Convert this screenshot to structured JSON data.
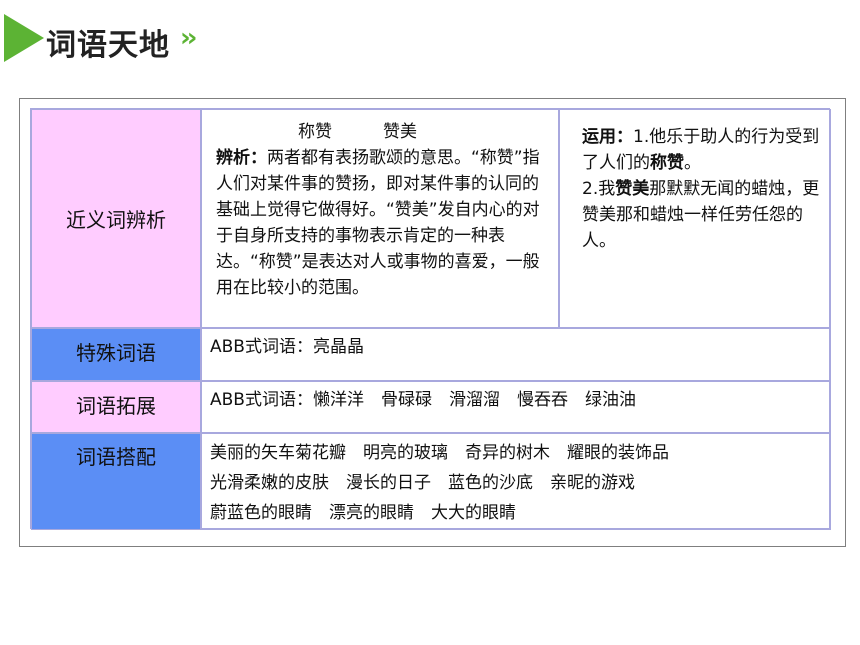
{
  "header": {
    "title": "词语天地",
    "chevrons": "››",
    "accent_color": "#5cb334"
  },
  "table": {
    "rows": [
      {
        "label": "近义词辨析",
        "label_bg": "#ffccff",
        "analysis": {
          "words": "称赞　　　赞美",
          "prefix": "辨析：",
          "body": "两者都有表扬歌颂的意思。“称赞”指人们对某件事的赞扬，即对某件事的认同的基础上觉得它做得好。“赞美”发自内心的对于自身所支持的事物表示肯定的一种表达。“称赞”是表达对人或事物的喜爱，一般用在比较小的范围。"
        },
        "usage": {
          "prefix": "运用：",
          "s1_a": "1.他乐于助人的行为受到了人们的",
          "s1_word": "称赞",
          "s1_b": "。",
          "s2_a": "2.我",
          "s2_word": "赞美",
          "s2_b": "那默默无闻的蜡烛，更赞美那和蜡烛一样任劳任怨的人。"
        }
      },
      {
        "label": "特殊词语",
        "label_bg": "#5b8ef5",
        "content": "ABB式词语：亮晶晶"
      },
      {
        "label": "词语拓展",
        "label_bg": "#ffccff",
        "content": "ABB式词语：懒洋洋　骨碌碌　滑溜溜　慢吞吞　绿油油"
      },
      {
        "label": "词语搭配",
        "label_bg": "#5b8ef5",
        "lines": [
          "美丽的矢车菊花瓣　明亮的玻璃　奇异的树木　耀眼的装饰品",
          "光滑柔嫩的皮肤　漫长的日子　蓝色的沙底　亲昵的游戏",
          "蔚蓝色的眼睛　漂亮的眼睛　大大的眼睛"
        ]
      }
    ]
  }
}
